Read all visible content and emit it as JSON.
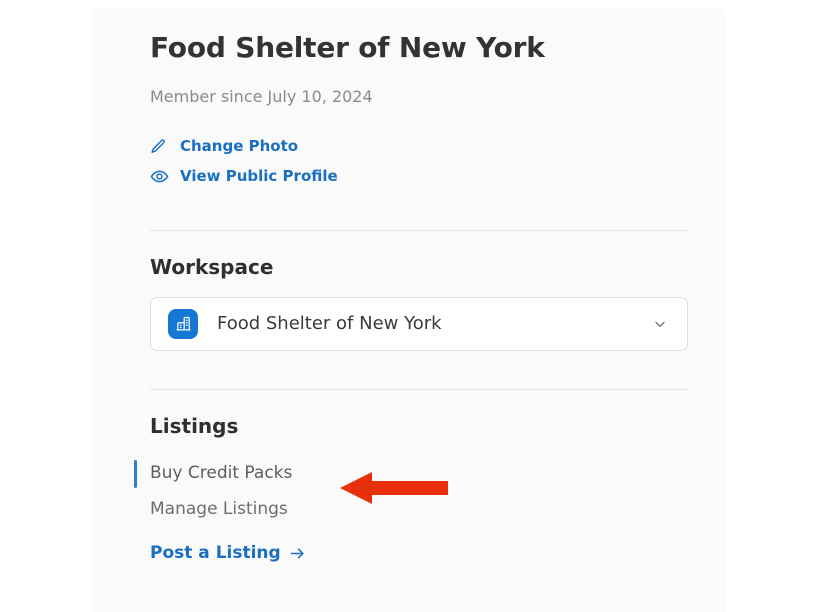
{
  "profile": {
    "title": "Food Shelter of New York",
    "member_since": "Member since July 10, 2024"
  },
  "quick_links": [
    {
      "icon": "pencil-icon",
      "label": "Change Photo"
    },
    {
      "icon": "eye-icon",
      "label": "View Public Profile"
    }
  ],
  "workspace": {
    "heading": "Workspace",
    "selected": "Food Shelter of New York",
    "badge_icon": "building-icon",
    "chevron_icon": "chevron-down-icon"
  },
  "listings": {
    "heading": "Listings",
    "items": [
      {
        "label": "Buy Credit Packs",
        "active": true
      },
      {
        "label": "Manage Listings",
        "active": false
      }
    ],
    "post_link": {
      "label": "Post a Listing",
      "arrow_icon": "arrow-right-icon"
    }
  },
  "annotation": {
    "type": "arrow-left-annotation",
    "color": "#e8300c",
    "points_at": "Buy Credit Packs"
  },
  "colors": {
    "link_blue": "#1a6fc4",
    "badge_blue": "#1477d4",
    "active_indicator": "#2a7fd0",
    "card_background": "#fafafa",
    "page_background": "#ffffff",
    "divider": "#e3e3e3",
    "title_text": "#333333",
    "muted_text": "#8a8a8a",
    "annotation_red": "#e8300c"
  }
}
